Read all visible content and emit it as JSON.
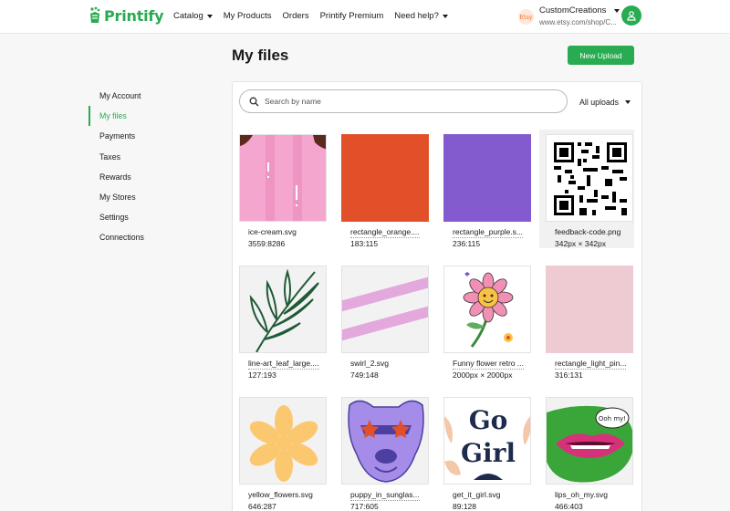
{
  "header": {
    "logo_text": "Printify",
    "nav": [
      {
        "label": "Catalog",
        "dropdown": true
      },
      {
        "label": "My Products",
        "dropdown": false
      },
      {
        "label": "Orders",
        "dropdown": false
      },
      {
        "label": "Printify Premium",
        "dropdown": false
      },
      {
        "label": "Need help?",
        "dropdown": true
      }
    ],
    "store": {
      "badge": "Etsy",
      "name": "CustomCreations",
      "url": "www.etsy.com/shop/C..."
    },
    "avatar_icon": "user-icon"
  },
  "page_title": "My files",
  "upload_button": "New Upload",
  "sidebar": {
    "items": [
      {
        "label": "My Account",
        "active": false
      },
      {
        "label": "My files",
        "active": true
      },
      {
        "label": "Payments",
        "active": false
      },
      {
        "label": "Taxes",
        "active": false
      },
      {
        "label": "Rewards",
        "active": false
      },
      {
        "label": "My Stores",
        "active": false
      },
      {
        "label": "Settings",
        "active": false
      },
      {
        "label": "Connections",
        "active": false
      }
    ]
  },
  "search": {
    "placeholder": "Search by name"
  },
  "filter": {
    "label": "All uploads"
  },
  "files": [
    {
      "name": "ice-cream.svg",
      "meta": "3559:8286",
      "thumb": "ice-cream"
    },
    {
      "name": "rectangle_orange....",
      "meta": "183:115",
      "thumb": "orange"
    },
    {
      "name": "rectangle_purple.s...",
      "meta": "236:115",
      "thumb": "purple"
    },
    {
      "name": "feedback-code.png",
      "meta": "342px × 342px",
      "thumb": "qr"
    },
    {
      "name": "line-art_leaf_large....",
      "meta": "127:193",
      "thumb": "leaf"
    },
    {
      "name": "swirl_2.svg",
      "meta": "749:148",
      "thumb": "swirl"
    },
    {
      "name": "Funny flower retro ...",
      "meta": "2000px × 2000px",
      "thumb": "flower"
    },
    {
      "name": "rectangle_light_pin...",
      "meta": "316:131",
      "thumb": "pink"
    },
    {
      "name": "yellow_flowers.svg",
      "meta": "646:287",
      "thumb": "yellow"
    },
    {
      "name": "puppy_in_sunglas...",
      "meta": "717:605",
      "thumb": "puppy"
    },
    {
      "name": "get_it_girl.svg",
      "meta": "89:128",
      "thumb": "girl"
    },
    {
      "name": "lips_oh_my.svg",
      "meta": "466:403",
      "thumb": "lips"
    }
  ],
  "thumb_text": {
    "girl_line1": "Go",
    "girl_line2": "Girl",
    "lips_bubble": "Ooh my!"
  },
  "colors": {
    "brand_green": "#29ab51",
    "orange": "#e2502a",
    "purple": "#845bcf",
    "light_pink": "#eecbd2",
    "ice_cream_pink": "#f4a6cf"
  }
}
